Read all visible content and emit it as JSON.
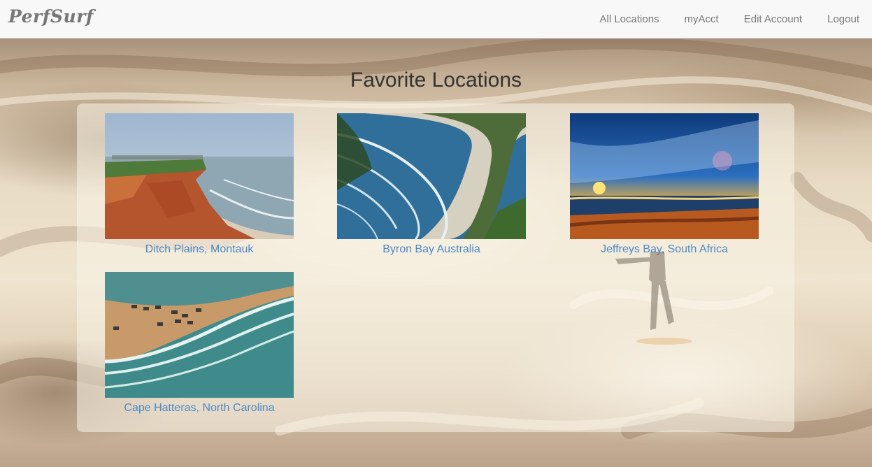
{
  "navbar": {
    "brand": "PerfSurf",
    "links": [
      "All Locations",
      "myAcct",
      "Edit Account",
      "Logout"
    ]
  },
  "page": {
    "title": "Favorite Locations"
  },
  "locations": [
    {
      "name": "Ditch Plains, Montauk"
    },
    {
      "name": "Byron Bay Australia"
    },
    {
      "name": "Jeffreys Bay, South Africa"
    },
    {
      "name": "Cape Hatteras, North Carolina"
    }
  ],
  "colors": {
    "link": "#4a89c8",
    "nav_text": "#777777",
    "title": "#333333"
  }
}
